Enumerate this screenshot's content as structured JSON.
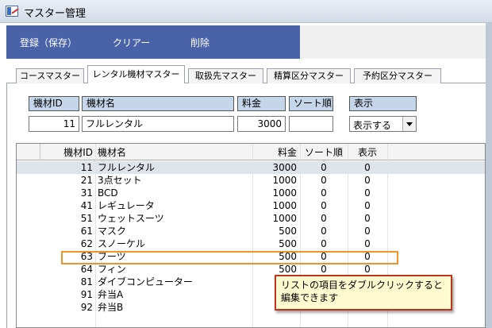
{
  "window": {
    "title": "マスター管理"
  },
  "toolbar": {
    "save_label": "登録（保存）",
    "clear_label": "クリアー",
    "delete_label": "削除"
  },
  "tabs": [
    {
      "label": "コースマスター",
      "active": false
    },
    {
      "label": "レンタル機材マスター",
      "active": true
    },
    {
      "label": "取扱先マスター",
      "active": false
    },
    {
      "label": "精算区分マスター",
      "active": false
    },
    {
      "label": "予約区分マスター",
      "active": false
    }
  ],
  "form": {
    "id_label": "機材ID",
    "name_label": "機材名",
    "price_label": "料金",
    "sort_label": "ソート順",
    "display_label": "表示",
    "id_value": "11",
    "name_value": "フルレンタル",
    "price_value": "3000",
    "sort_value": "",
    "display_value": "表示する"
  },
  "table": {
    "columns": [
      "機材ID",
      "機材名",
      "料金",
      "ソート順",
      "表示"
    ],
    "rows": [
      [
        "11",
        "フルレンタル",
        "3000",
        "0",
        "0"
      ],
      [
        "21",
        "3点セット",
        "1000",
        "0",
        "0"
      ],
      [
        "31",
        "BCD",
        "1000",
        "0",
        "0"
      ],
      [
        "41",
        "レギュレータ",
        "1000",
        "0",
        "0"
      ],
      [
        "51",
        "ウェットスーツ",
        "1000",
        "0",
        "0"
      ],
      [
        "61",
        "マスク",
        "500",
        "0",
        "0"
      ],
      [
        "62",
        "スノーケル",
        "500",
        "0",
        "0"
      ],
      [
        "63",
        "ブーツ",
        "500",
        "0",
        "0"
      ],
      [
        "64",
        "フィン",
        "500",
        "0",
        "0"
      ],
      [
        "81",
        "ダイブコンピューター",
        "",
        "",
        ""
      ],
      [
        "91",
        "弁当A",
        "",
        "",
        ""
      ],
      [
        "92",
        "弁当B",
        "",
        "",
        ""
      ]
    ]
  },
  "callout": {
    "text": "リストの項目をダブルクリックすると編集できます"
  },
  "colors": {
    "toolbar": "#4a63a8",
    "label_bg": "#c6d6ea",
    "highlight": "#f0932b",
    "callout_border": "#c0341b",
    "callout_bg": "#fffbd0"
  }
}
